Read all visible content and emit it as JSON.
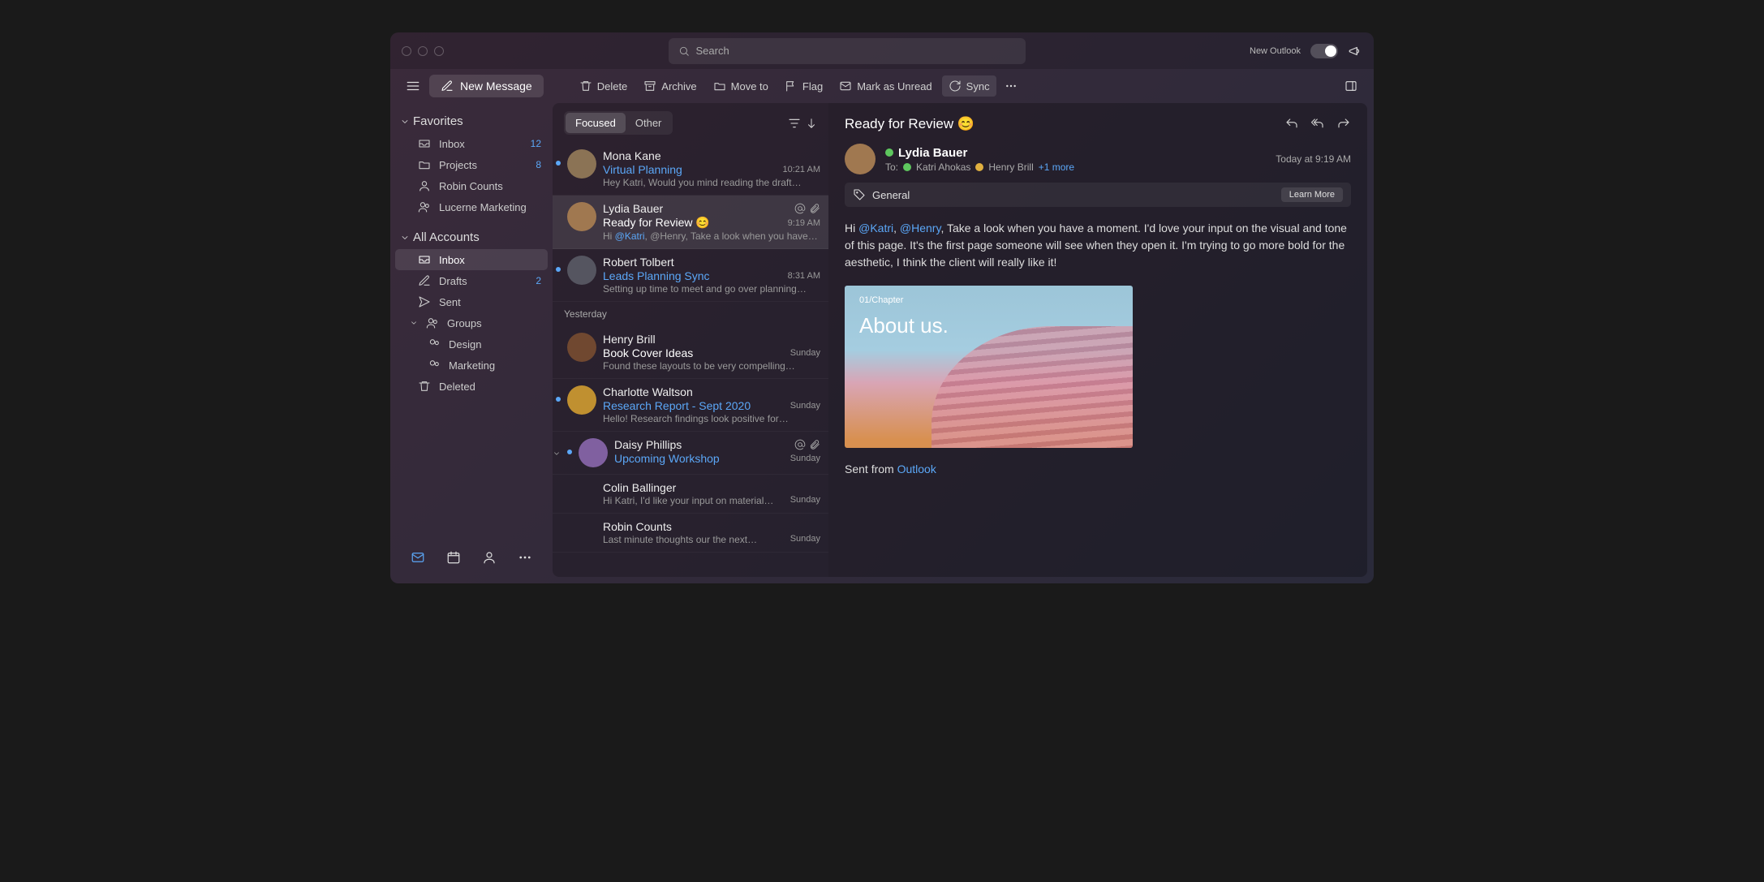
{
  "titlebar": {
    "search_placeholder": "Search",
    "new_outlook_label": "New Outlook"
  },
  "toolbar": {
    "new_message": "New Message",
    "delete": "Delete",
    "archive": "Archive",
    "move_to": "Move to",
    "flag": "Flag",
    "mark_unread": "Mark as Unread",
    "sync": "Sync"
  },
  "sidebar": {
    "favorites_title": "Favorites",
    "favorites": [
      {
        "label": "Inbox",
        "count": "12"
      },
      {
        "label": "Projects",
        "count": "8"
      },
      {
        "label": "Robin Counts"
      },
      {
        "label": "Lucerne Marketing"
      }
    ],
    "all_accounts_title": "All Accounts",
    "accounts": [
      {
        "label": "Inbox"
      },
      {
        "label": "Drafts",
        "count": "2"
      },
      {
        "label": "Sent"
      },
      {
        "label": "Groups"
      },
      {
        "label": "Design",
        "sub": true
      },
      {
        "label": "Marketing",
        "sub": true
      },
      {
        "label": "Deleted"
      }
    ]
  },
  "msglist": {
    "focused": "Focused",
    "other": "Other",
    "yesterday": "Yesterday",
    "items": [
      {
        "sender": "Mona Kane",
        "subject": "Virtual Planning",
        "preview": "Hey Katri, Would you mind reading the draft…",
        "time": "10:21 AM",
        "unread": true,
        "avatar": "#8b7355"
      },
      {
        "sender": "Lydia Bauer",
        "subject": "Ready for Review 😊",
        "preview_prefix": "Hi ",
        "mention": "@Katri",
        "preview_suffix": ", @Henry, Take a look when you have…",
        "time": "9:19 AM",
        "unread": false,
        "selected": true,
        "at": true,
        "attach": true,
        "avatar": "#a07850"
      },
      {
        "sender": "Robert Tolbert",
        "subject": "Leads Planning Sync",
        "preview": "Setting up time to meet and go over planning…",
        "time": "8:31 AM",
        "unread": true,
        "avatar": "#555560"
      },
      {
        "sender": "Henry Brill",
        "subject": "Book Cover Ideas",
        "preview": "Found these layouts to be very compelling…",
        "time": "Sunday",
        "unread": false,
        "avatar": "#704830"
      },
      {
        "sender": "Charlotte Waltson",
        "subject": "Research Report - Sept 2020",
        "preview": "Hello! Research findings look positive for…",
        "time": "Sunday",
        "unread": true,
        "avatar": "#c09030"
      },
      {
        "sender": "Daisy Phillips",
        "subject": "Upcoming Workshop",
        "preview": "",
        "time": "Sunday",
        "unread": true,
        "at": true,
        "attach": true,
        "expand": true,
        "avatar": "#8060a0"
      },
      {
        "sender": "Colin Ballinger",
        "subject": "",
        "preview": "Hi Katri, I'd like your input on material…",
        "time": "Sunday",
        "unread": false,
        "noavatar": true
      },
      {
        "sender": "Robin Counts",
        "subject": "",
        "preview": "Last minute thoughts our the next…",
        "time": "Sunday",
        "unread": false,
        "noavatar": true
      }
    ]
  },
  "reading": {
    "subject": "Ready for Review 😊",
    "from_name": "Lydia Bauer",
    "to_label": "To:",
    "recipients": [
      "Katri Ahokas",
      "Henry Brill"
    ],
    "more": "+1 more",
    "timestamp": "Today at 9:19 AM",
    "tag": "General",
    "learn_more": "Learn More",
    "body_prefix": "Hi ",
    "mention1": "@Katri",
    "sep": ", ",
    "mention2": "@Henry",
    "body_rest": ", Take a look when you have a moment. I'd love your input on the visual and tone of this page. It's the first page someone will see when they open it. I'm trying to go more bold for the aesthetic, I think the client will really like it!",
    "image_label1": "01/Chapter",
    "image_label2": "About us.",
    "signature_prefix": "Sent from ",
    "signature_link": "Outlook"
  }
}
